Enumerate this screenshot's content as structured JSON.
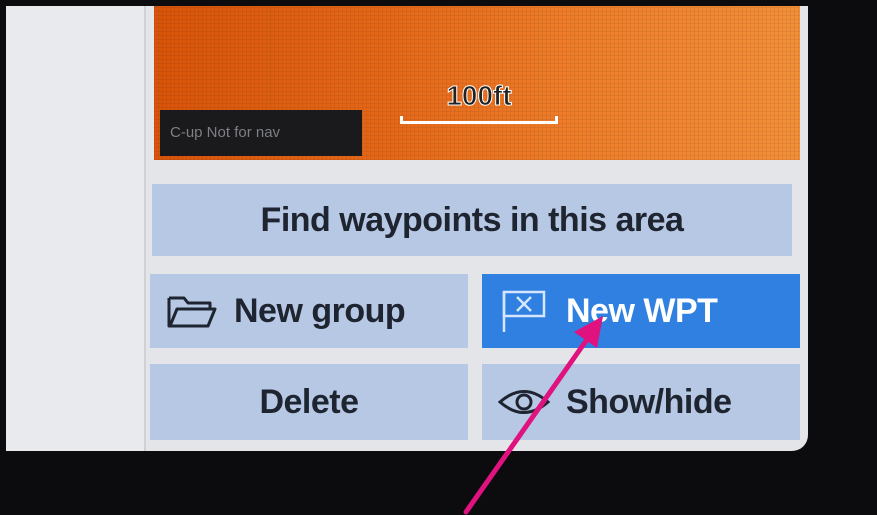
{
  "map": {
    "scale_label": "100ft",
    "status_text": "C-up   Not for nav"
  },
  "actions": {
    "find_label": "Find waypoints in this area",
    "new_group_label": "New group",
    "new_wpt_label": "New WPT",
    "delete_label": "Delete",
    "show_hide_label": "Show/hide"
  },
  "icons": {
    "new_group": "folder-icon",
    "new_wpt": "flag-icon",
    "show_hide": "eye-icon"
  },
  "colors": {
    "map_orange": "#e46718",
    "button_blue_light": "#b6c8e3",
    "button_blue_selected": "#2f80e0",
    "annotation_arrow": "#e0127f"
  }
}
